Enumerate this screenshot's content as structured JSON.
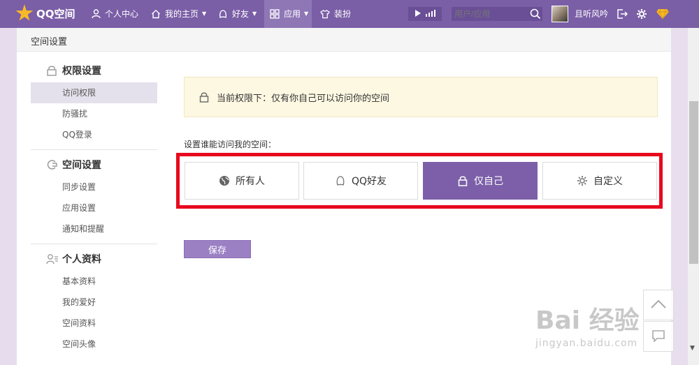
{
  "topbar": {
    "logo_text": "QQ空间",
    "nav": [
      {
        "label": "个人中心",
        "icon": "person-icon",
        "caret": false
      },
      {
        "label": "我的主页",
        "icon": "home-icon",
        "caret": true
      },
      {
        "label": "好友",
        "icon": "friends-icon",
        "caret": true
      },
      {
        "label": "应用",
        "icon": "grid-icon",
        "caret": true,
        "active": true
      },
      {
        "label": "装扮",
        "icon": "shirt-icon",
        "caret": true
      }
    ],
    "search_placeholder": "用户/应用",
    "username": "且听风吟",
    "caret_glyph": "▼"
  },
  "panel": {
    "title": "空间设置"
  },
  "sidebar": {
    "groups": [
      {
        "title": "权限设置",
        "icon": "lock-icon",
        "items": [
          "访问权限",
          "防骚扰",
          "QQ登录"
        ]
      },
      {
        "title": "空间设置",
        "icon": "space-icon",
        "items": [
          "同步设置",
          "应用设置",
          "通知和提醒"
        ]
      },
      {
        "title": "个人资料",
        "icon": "profile-icon",
        "items": [
          "基本资料",
          "我的爱好",
          "空间资料",
          "空间头像"
        ]
      }
    ],
    "active_item": "访问权限"
  },
  "content": {
    "notice": "当前权限下：仅有你自己可以访问你的空间",
    "prompt": "设置谁能访问我的空间：",
    "options": [
      {
        "label": "所有人",
        "icon": "globe-icon"
      },
      {
        "label": "QQ好友",
        "icon": "penguin-icon"
      },
      {
        "label": "仅自己",
        "icon": "lock-icon",
        "selected": true
      },
      {
        "label": "自定义",
        "icon": "gear-icon"
      }
    ],
    "save_label": "保存"
  },
  "watermark": {
    "main": "Bai 经验",
    "sub": "jingyan.baidu.com"
  },
  "colors": {
    "nav_bg": "#7a5ea6",
    "selected": "#7c5fa8",
    "highlight_border": "#e8091d",
    "notice_bg": "#fdf8e2",
    "save_btn": "#9b80c4"
  }
}
